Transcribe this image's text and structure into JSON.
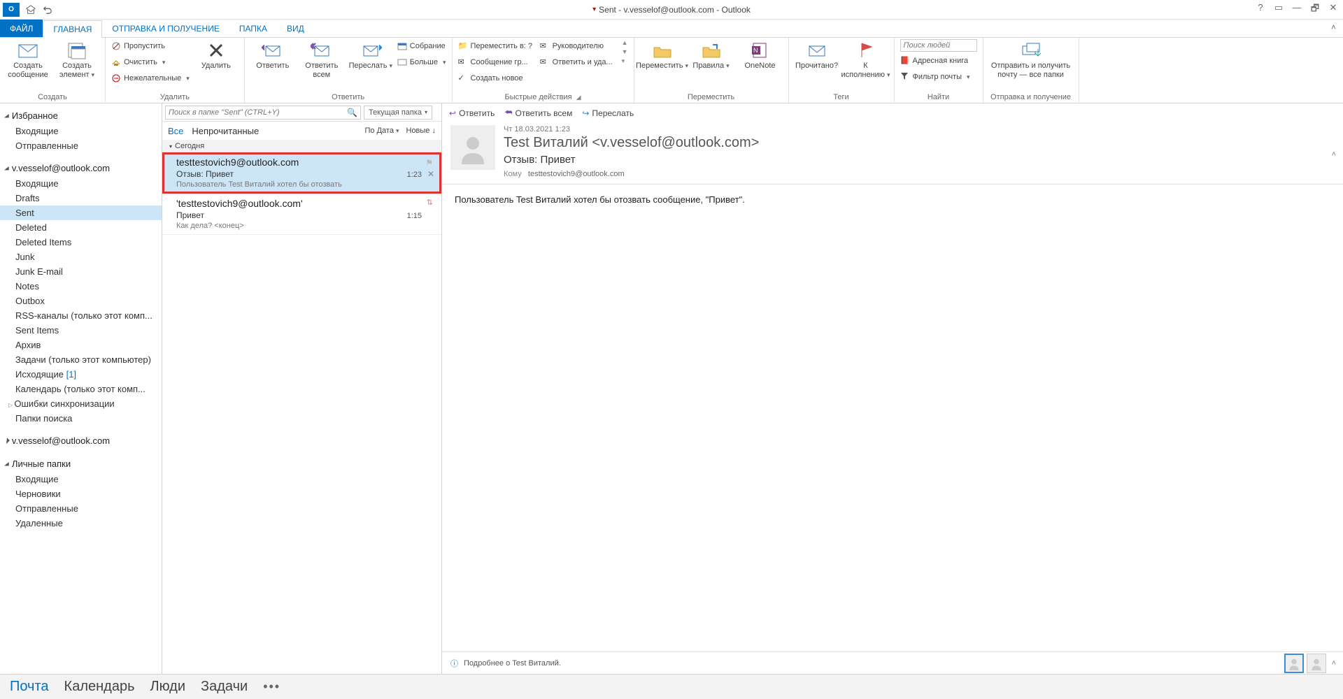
{
  "window": {
    "title": "Sent - v.vesselof@outlook.com - Outlook"
  },
  "tabs": {
    "file": "ФАЙЛ",
    "home": "ГЛАВНАЯ",
    "sendrecv": "ОТПРАВКА И ПОЛУЧЕНИЕ",
    "folder": "ПАПКА",
    "view": "ВИД"
  },
  "ribbon": {
    "create": {
      "new_msg": "Создать сообщение",
      "new_items": "Создать элемент",
      "label": "Создать"
    },
    "delete_grp": {
      "ignore": "Пропустить",
      "cleanup": "Очистить",
      "junk": "Нежелательные",
      "delete": "Удалить",
      "label": "Удалить"
    },
    "respond": {
      "reply": "Ответить",
      "reply_all": "Ответить всем",
      "forward": "Переслать",
      "meeting": "Собрание",
      "more": "Больше",
      "label": "Ответить"
    },
    "quick": {
      "move_to": "Переместить в: ?",
      "to_manager": "Руководителю",
      "team_msg": "Сообщение гр...",
      "reply_delete": "Ответить и уда...",
      "create_new": "Создать новое",
      "label": "Быстрые действия"
    },
    "move": {
      "move": "Переместить",
      "rules": "Правила",
      "onenote": "OneNote",
      "label": "Переместить"
    },
    "tags": {
      "unread": "Прочитано?",
      "followup": "К исполнению",
      "label": "Теги"
    },
    "find": {
      "search_people_ph": "Поиск людей",
      "address_book": "Адресная книга",
      "filter": "Фильтр почты",
      "label": "Найти"
    },
    "sendrecv_grp": {
      "big": "Отправить и получить почту — все папки",
      "label": "Отправка и получение"
    }
  },
  "nav": {
    "favorites": {
      "title": "Избранное",
      "items": [
        "Входящие",
        "Отправленные"
      ]
    },
    "account1": {
      "title": "v.vesselof@outlook.com",
      "items": [
        {
          "name": "Входящие"
        },
        {
          "name": "Drafts"
        },
        {
          "name": "Sent",
          "selected": true
        },
        {
          "name": "Deleted"
        },
        {
          "name": "Deleted Items"
        },
        {
          "name": "Junk"
        },
        {
          "name": "Junk E-mail"
        },
        {
          "name": "Notes"
        },
        {
          "name": "Outbox"
        },
        {
          "name": "RSS-каналы (только этот комп..."
        },
        {
          "name": "Sent Items"
        },
        {
          "name": "Архив"
        },
        {
          "name": "Задачи (только этот компьютер)"
        },
        {
          "name": "Исходящие",
          "count": "[1]"
        },
        {
          "name": "Календарь (только этот комп..."
        },
        {
          "name": "Ошибки синхронизации",
          "expandable": true
        },
        {
          "name": "Папки поиска"
        }
      ]
    },
    "account2": {
      "title": "v.vesselof@outlook.com"
    },
    "personal": {
      "title": "Личные папки",
      "items": [
        "Входящие",
        "Черновики",
        "Отправленные",
        "Удаленные"
      ]
    }
  },
  "list": {
    "search_ph": "Поиск в папке \"Sent\" (CTRL+Y)",
    "scope": "Текущая папка",
    "filters": {
      "all": "Все",
      "unread": "Непрочитанные",
      "by_date": "По Дата",
      "newest": "Новые"
    },
    "group": "Сегодня",
    "items": [
      {
        "from": "testtestovich9@outlook.com",
        "subject": "Отзыв: Привет",
        "preview": "Пользователь Test Виталий хотел бы отозвать",
        "time": "1:23",
        "selected": true,
        "highlighted": true
      },
      {
        "from": "'testtestovich9@outlook.com'",
        "subject": "Привет",
        "preview": "Как дела?  <конец>",
        "time": "1:15"
      }
    ]
  },
  "reading": {
    "actions": {
      "reply": "Ответить",
      "reply_all": "Ответить всем",
      "forward": "Переслать"
    },
    "date": "Чт 18.03.2021 1:23",
    "from": "Test Виталий <v.vesselof@outlook.com>",
    "subject": "Отзыв: Привет",
    "to_label": "Кому",
    "to": "testtestovich9@outlook.com",
    "body": "Пользователь Test Виталий хотел бы отозвать сообщение, \"Привет\".",
    "info": "Подробнее о Test Виталий."
  },
  "bottom": {
    "mail": "Почта",
    "calendar": "Календарь",
    "people": "Люди",
    "tasks": "Задачи"
  }
}
